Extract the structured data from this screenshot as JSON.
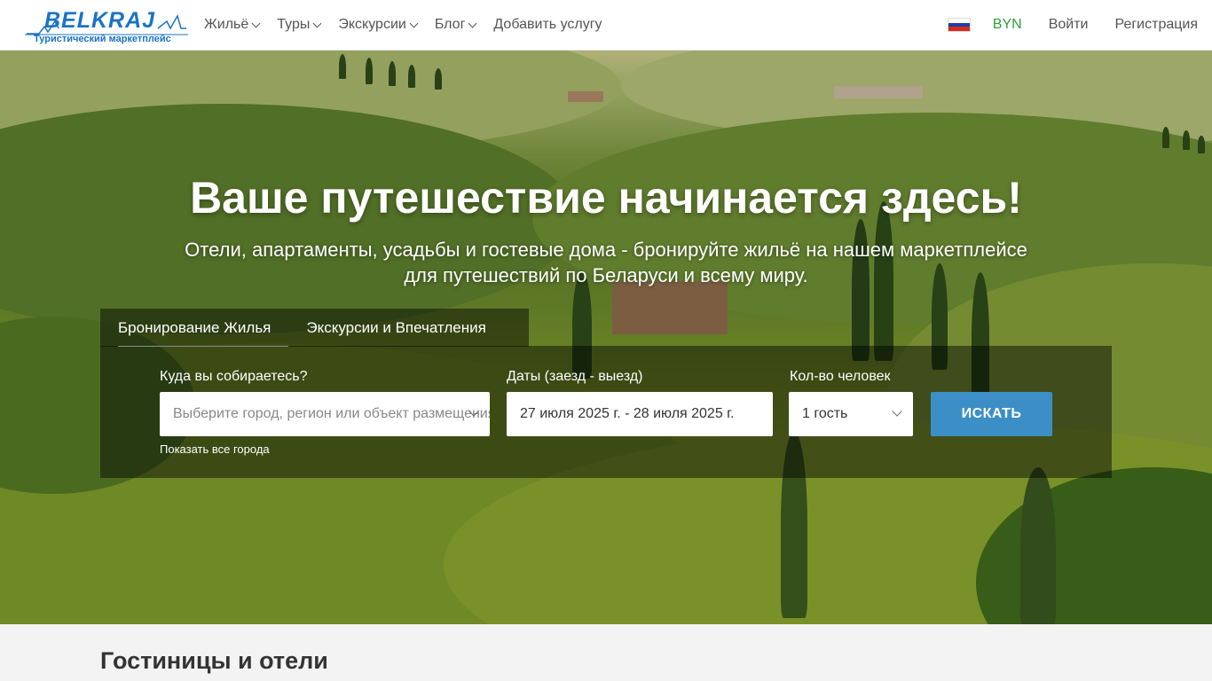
{
  "logo": {
    "word": "BELKRAJ",
    "tagline": "Туристический маркетплейс"
  },
  "nav": {
    "items": [
      {
        "label": "Жильё",
        "dropdown": true
      },
      {
        "label": "Туры",
        "dropdown": true
      },
      {
        "label": "Экскурсии",
        "dropdown": true
      },
      {
        "label": "Блог",
        "dropdown": true
      },
      {
        "label": "Добавить услугу",
        "dropdown": false
      }
    ],
    "currency": "BYN",
    "login": "Войти",
    "register": "Регистрация",
    "language_icon": "russia-flag-icon"
  },
  "hero": {
    "title": "Ваше путешествие начинается здесь!",
    "subtitle": "Отели, апартаменты, усадьбы и гостевые дома - бронируйте жильё на нашем маркетплейсе для путешествий по Беларуси и всему миру."
  },
  "search": {
    "tabs": [
      "Бронирование Жилья",
      "Экскурсии и Впечатления"
    ],
    "active_tab": 0,
    "destination_label": "Куда вы собираетесь?",
    "destination_placeholder": "Выберите город, регион или объект размещения",
    "dates_label": "Даты (заезд - выезд)",
    "dates_value": "27 июля 2025 г. - 28 июля 2025 г.",
    "guests_label": "Кол-во человек",
    "guests_value": "1 гость",
    "show_all": "Показать все города",
    "button": "ИСКАТЬ"
  },
  "section": {
    "title": "Гостиницы и отели"
  },
  "colors": {
    "brand": "#1a73c6",
    "currency": "#2e9e3c",
    "button": "#3b8fc6"
  }
}
